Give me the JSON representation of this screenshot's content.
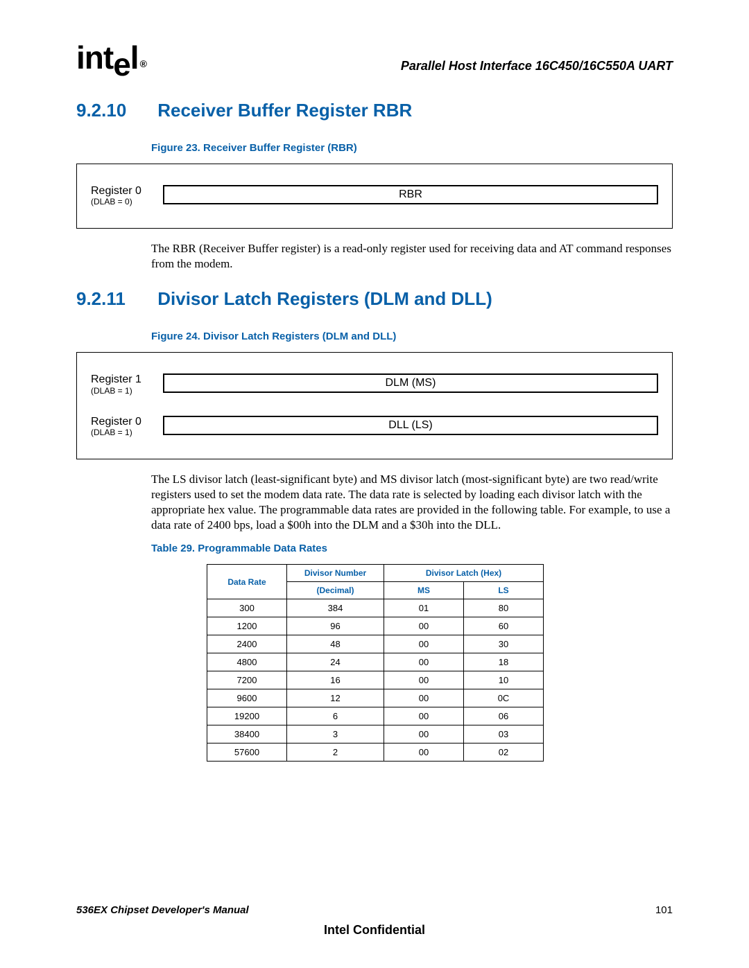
{
  "header": {
    "logo_text": "intel",
    "doc_title": "Parallel Host Interface 16C450/16C550A UART"
  },
  "section1": {
    "number": "9.2.10",
    "title": "Receiver Buffer Register RBR",
    "figure_caption": "Figure 23. Receiver Buffer Register (RBR)",
    "reg_label": "Register 0",
    "reg_sub": "(DLAB = 0)",
    "reg_box": "RBR",
    "body": "The RBR (Receiver Buffer register) is a read-only register used for receiving data and AT command responses from the modem."
  },
  "section2": {
    "number": "9.2.11",
    "title": "Divisor Latch Registers (DLM and DLL)",
    "figure_caption": "Figure 24. Divisor Latch Registers (DLM and DLL)",
    "reg1_label": "Register 1",
    "reg1_sub": "(DLAB = 1)",
    "reg1_box": "DLM (MS)",
    "reg0_label": "Register 0",
    "reg0_sub": "(DLAB = 1)",
    "reg0_box": "DLL (LS)",
    "body": "The LS divisor latch (least-significant byte) and MS divisor latch (most-significant byte) are two read/write registers used to set the modem data rate. The data rate is selected by loading each divisor latch with the appropriate hex value. The programmable data rates are provided in the following table. For example, to use a data rate of 2400 bps, load a $00h into the DLM and a $30h into the DLL.",
    "table_caption": "Table 29.  Programmable Data Rates",
    "table_head": {
      "col1": "Data Rate",
      "col2": "Divisor Number",
      "col3": "Divisor Latch (Hex)",
      "sub2": "(Decimal)",
      "sub3a": "MS",
      "sub3b": "LS"
    },
    "rows": [
      {
        "rate": "300",
        "div": "384",
        "ms": "01",
        "ls": "80"
      },
      {
        "rate": "1200",
        "div": "96",
        "ms": "00",
        "ls": "60"
      },
      {
        "rate": "2400",
        "div": "48",
        "ms": "00",
        "ls": "30"
      },
      {
        "rate": "4800",
        "div": "24",
        "ms": "00",
        "ls": "18"
      },
      {
        "rate": "7200",
        "div": "16",
        "ms": "00",
        "ls": "10"
      },
      {
        "rate": "9600",
        "div": "12",
        "ms": "00",
        "ls": "0C"
      },
      {
        "rate": "19200",
        "div": "6",
        "ms": "00",
        "ls": "06"
      },
      {
        "rate": "38400",
        "div": "3",
        "ms": "00",
        "ls": "03"
      },
      {
        "rate": "57600",
        "div": "2",
        "ms": "00",
        "ls": "02"
      }
    ]
  },
  "footer": {
    "manual": "536EX Chipset Developer's Manual",
    "page": "101",
    "confidential": "Intel Confidential"
  },
  "chart_data": {
    "type": "table",
    "title": "Programmable Data Rates",
    "columns": [
      "Data Rate",
      "Divisor Number (Decimal)",
      "Divisor Latch MS (Hex)",
      "Divisor Latch LS (Hex)"
    ],
    "rows": [
      [
        300,
        384,
        "01",
        "80"
      ],
      [
        1200,
        96,
        "00",
        "60"
      ],
      [
        2400,
        48,
        "00",
        "30"
      ],
      [
        4800,
        24,
        "00",
        "18"
      ],
      [
        7200,
        16,
        "00",
        "10"
      ],
      [
        9600,
        12,
        "00",
        "0C"
      ],
      [
        19200,
        6,
        "00",
        "06"
      ],
      [
        38400,
        3,
        "00",
        "03"
      ],
      [
        57600,
        2,
        "00",
        "02"
      ]
    ]
  }
}
